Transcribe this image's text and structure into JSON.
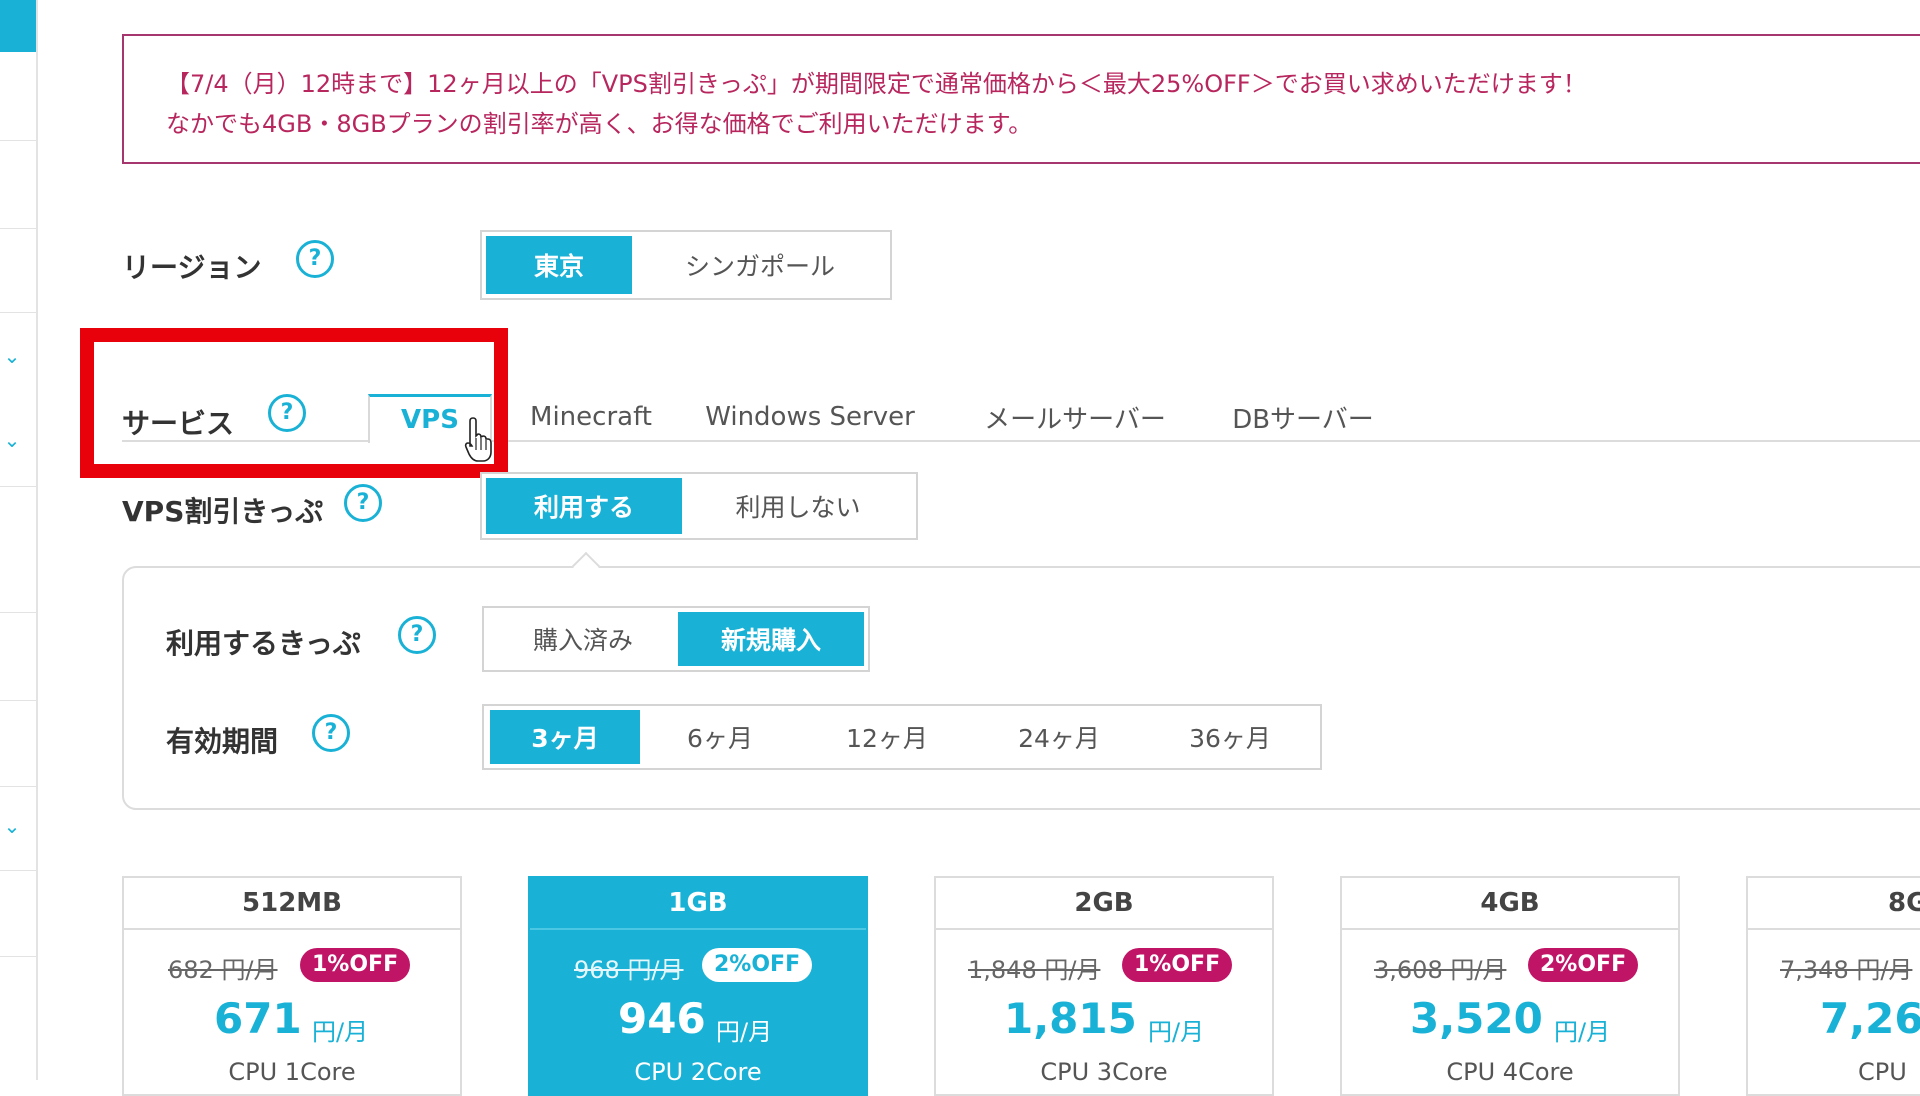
{
  "notice": {
    "line1": "【7/4（月）12時まで】12ヶ月以上の「VPS割引きっぷ」が期間限定で通常価格から＜最大25%OFF＞でお買い求めいただけます！",
    "line2": "なかでも4GB・8GBプランの割引率が高く、お得な価格でご利用いただけます。"
  },
  "region": {
    "label": "リージョン",
    "options": [
      "東京",
      "シンガポール"
    ],
    "selected": "東京"
  },
  "service": {
    "label": "サービス",
    "tabs": [
      "VPS",
      "Minecraft",
      "Windows Server",
      "メールサーバー",
      "DBサーバー"
    ],
    "selected": "VPS"
  },
  "discount_ticket": {
    "label": "VPS割引きっぷ",
    "options": [
      "利用する",
      "利用しない"
    ],
    "selected": "利用する"
  },
  "ticket_type": {
    "label": "利用するきっぷ",
    "options": [
      "購入済み",
      "新規購入"
    ],
    "selected": "新規購入"
  },
  "validity": {
    "label": "有効期間",
    "options": [
      "3ヶ月",
      "6ヶ月",
      "12ヶ月",
      "24ヶ月",
      "36ヶ月"
    ],
    "selected": "3ヶ月"
  },
  "help_glyph": "?",
  "plans": [
    {
      "name": "512MB",
      "old": "682 円/月",
      "badge": "1%OFF",
      "price": "671",
      "unit": "円/月",
      "cpu": "CPU 1Core",
      "selected": false
    },
    {
      "name": "1GB",
      "old": "968 円/月",
      "badge": "2%OFF",
      "price": "946",
      "unit": "円/月",
      "cpu": "CPU 2Core",
      "selected": true
    },
    {
      "name": "2GB",
      "old": "1,848 円/月",
      "badge": "1%OFF",
      "price": "1,815",
      "unit": "円/月",
      "cpu": "CPU 3Core",
      "selected": false
    },
    {
      "name": "4GB",
      "old": "3,608 円/月",
      "badge": "2%OFF",
      "price": "3,520",
      "unit": "円/月",
      "cpu": "CPU 4Core",
      "selected": false
    },
    {
      "name": "8G",
      "old": "7,348 円/月",
      "badge": "",
      "price": "7,26",
      "unit": "",
      "cpu": "CPU",
      "selected": false
    }
  ],
  "colors": {
    "accent": "#19b2d6",
    "notice_text": "#b8265e",
    "badge": "#c01466",
    "highlight_box": "#e8000a"
  }
}
